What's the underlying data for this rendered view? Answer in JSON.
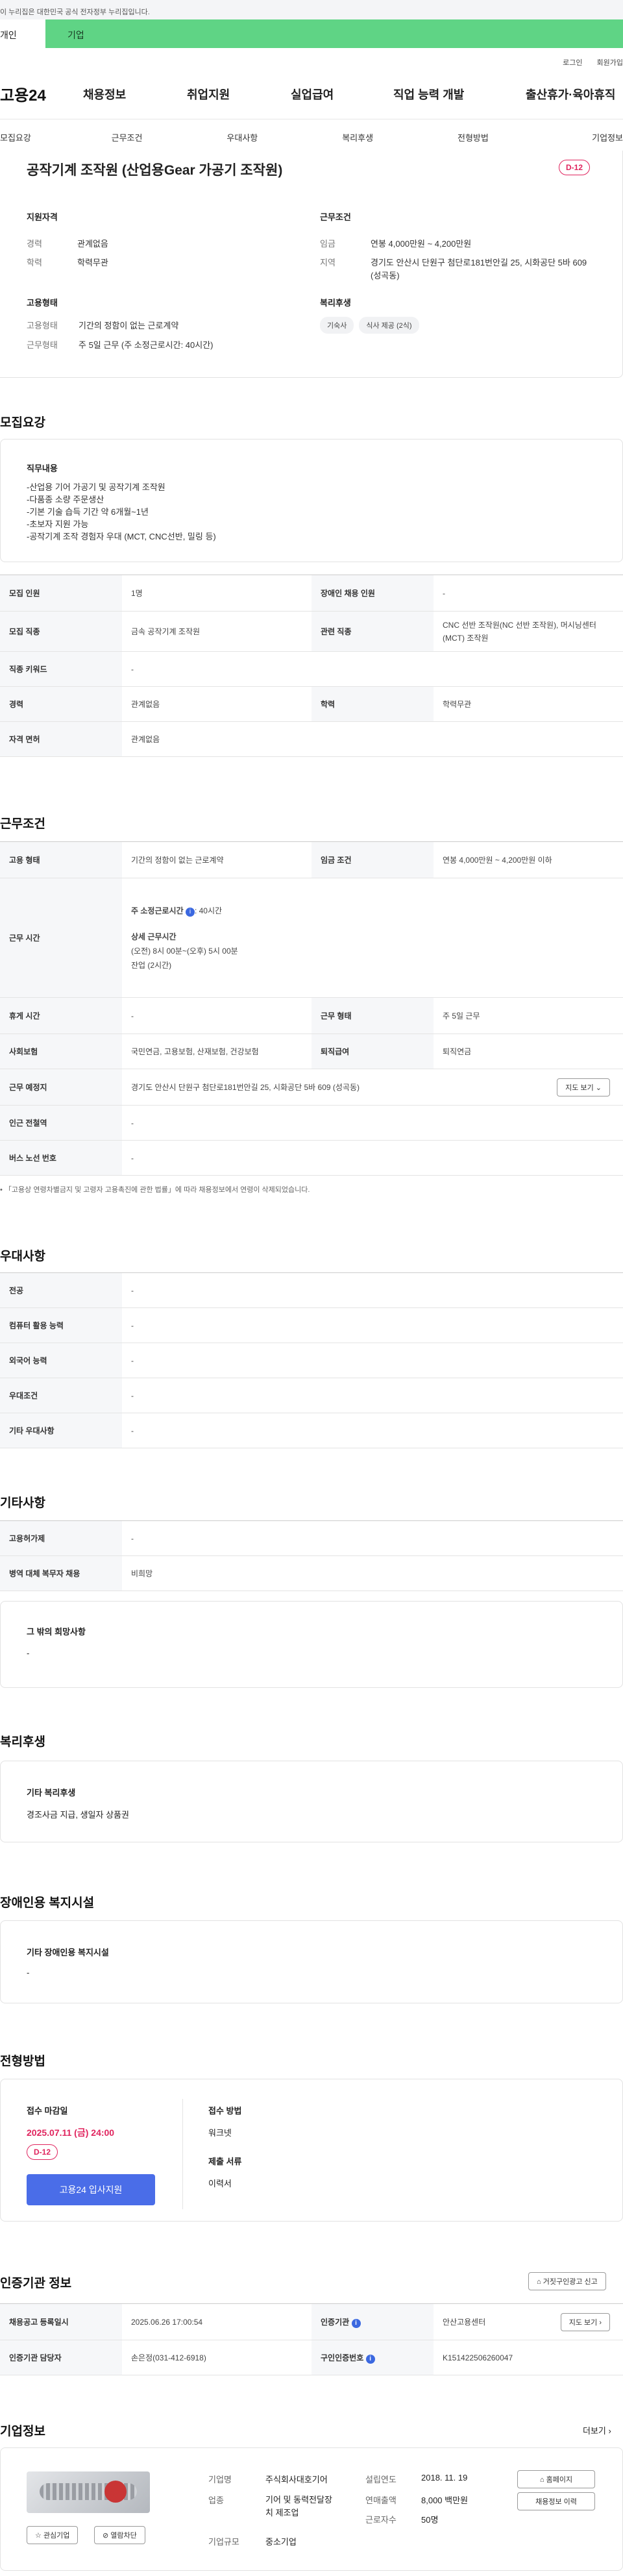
{
  "gov_banner": "이 누리집은 대한민국 공식 전자정부 누리집입니다.",
  "tabs": {
    "person": "개인",
    "company": "기업"
  },
  "util": {
    "login": "로그인",
    "join": "회원가입"
  },
  "brand": "고용24",
  "gnb": [
    "채용정보",
    "취업지원",
    "실업급여",
    "직업 능력 개발",
    "출산휴가·육아휴직"
  ],
  "anchors": [
    "모집요강",
    "근무조건",
    "우대사항",
    "복리후생",
    "전형방법",
    "기업정보"
  ],
  "summary": {
    "title": "공작기계 조작원 (산업용Gear 가공기 조작원)",
    "dday": "D-12",
    "qual_title": "지원자격",
    "qual": [
      {
        "k": "경력",
        "v": "관계없음"
      },
      {
        "k": "학력",
        "v": "학력무관"
      }
    ],
    "emp_title": "고용형태",
    "emp": [
      {
        "k": "고용형태",
        "v": "기간의 정함이 없는 근로계약"
      },
      {
        "k": "근무형태",
        "v": "주 5일 근무 (주 소정근로시간: 40시간)"
      }
    ],
    "cond_title": "근무조건",
    "cond": [
      {
        "k": "임금",
        "v": "연봉 4,000만원 ~ 4,200만원"
      },
      {
        "k": "지역",
        "v": "경기도 안산시 단원구 첨단로181번안길 25, 시화공단 5바 609 (성곡동)"
      }
    ],
    "welfare_title": "복리후생",
    "welfare_tags": [
      "기숙사",
      "식사 제공 (2식)"
    ]
  },
  "recruit": {
    "title": "모집요강",
    "duty_title": "직무내용",
    "duty_lines": [
      "-산업용 기어 가공기 및 공작기계 조작원",
      "-다품종 소량 주문생산",
      "-기본 기술 습득 기간 약 6개월~1년",
      "-초보자 지원 가능",
      "-공작기계 조작 경험자 우대 (MCT, CNC선반, 밀링 등)"
    ],
    "rows": [
      {
        "k1": "모집 인원",
        "v1": "1명",
        "k2": "장애인 채용 인원",
        "v2": "-"
      },
      {
        "k1": "모집 직종",
        "v1": "금속 공작기계 조작원",
        "k2": "관련 직종",
        "v2": "CNC 선반 조작원(NC 선반 조작원), 머시닝센터(MCT) 조작원"
      },
      {
        "k1": "직종 키워드",
        "v1": "-"
      },
      {
        "k1": "경력",
        "v1": "관계없음",
        "k2": "학력",
        "v2": "학력무관"
      },
      {
        "k1": "자격 면허",
        "v1": "관계없음"
      }
    ]
  },
  "work": {
    "title": "근무조건",
    "emp_type_k": "고용 형태",
    "emp_type_v": "기간의 정함이 없는 근로계약",
    "wage_k": "임금 조건",
    "wage_v": "연봉 4,000만원 ~ 4,200만원 이하",
    "hours_k": "근무 시간",
    "hours_weekly": "주 소정근로시간",
    "hours_weekly_v": ": 40시간",
    "hours_detail_title": "상세 근무시간",
    "hours_detail_1": "(오전) 8시 00분~(오후) 5시 00분",
    "hours_detail_2": "잔업 (2시간)",
    "rest_k": "휴게 시간",
    "rest_v": "-",
    "shift_k": "근무 형태",
    "shift_v": "주 5일 근무",
    "ins_k": "사회보험",
    "ins_v": "국민연금, 고용보험, 산재보험, 건강보험",
    "sev_k": "퇴직급여",
    "sev_v": "퇴직연금",
    "place_k": "근무 예정지",
    "place_v": "경기도 안산시 단원구 첨단로181번안길 25, 시화공단 5바 609 (성곡동)",
    "map_btn": "지도 보기",
    "subway_k": "인근 전철역",
    "subway_v": "-",
    "bus_k": "버스 노선 번호",
    "bus_v": "-",
    "note": "「고용상 연령차별금지 및 고령자 고용촉진에 관한 법률」에 따라 채용정보에서 연령이 삭제되었습니다."
  },
  "pref": {
    "title": "우대사항",
    "rows": [
      {
        "k": "전공",
        "v": "-"
      },
      {
        "k": "컴퓨터 활용 능력",
        "v": "-"
      },
      {
        "k": "외국어 능력",
        "v": "-"
      },
      {
        "k": "우대조건",
        "v": "-"
      },
      {
        "k": "기타 우대사항",
        "v": "-"
      }
    ]
  },
  "etc": {
    "title": "기타사항",
    "rows": [
      {
        "k": "고용허가제",
        "v": "-"
      },
      {
        "k": "병역 대체 복무자 채용",
        "v": "비희망"
      }
    ],
    "hope_title": "그 밖의 희망사항",
    "hope_v": "-"
  },
  "welfare": {
    "title": "복리후생",
    "box_title": "기타 복리후생",
    "box_v": "경조사금 지급, 생일자 상품권"
  },
  "disabled": {
    "title": "장애인용 복지시설",
    "box_title": "기타 장애인용 복지시설",
    "box_v": "-"
  },
  "selection": {
    "title": "전형방법",
    "deadline_title": "접수 마감일",
    "deadline": "2025.07.11 (금) 24:00",
    "dday": "D-12",
    "apply_btn": "고용24 입사지원",
    "method_title": "접수 방법",
    "method_v": "워크넷",
    "docs_title": "제출 서류",
    "docs_v": "이력서"
  },
  "agency": {
    "title": "인증기관 정보",
    "report_btn": "거짓구인광고 신고",
    "reg_k": "채용공고 등록일시",
    "reg_v": "2025.06.26 17:00:54",
    "org_k": "인증기관",
    "org_v": "안산고용센터",
    "map_btn": "지도 보기",
    "mgr_k": "인증기관 담당자",
    "mgr_v": "손은정(031-412-6918)",
    "num_k": "구인인증번호",
    "num_v": "K151422506260047"
  },
  "company": {
    "title": "기업정보",
    "more": "더보기",
    "interest_btn": "관심기업",
    "block_btn": "열람차단",
    "name_k": "기업명",
    "name_v": "주식회사대호기어",
    "biz_k": "업종",
    "biz_v": "기어 및 동력전달장치 제조업",
    "size_k": "기업규모",
    "size_v": "중소기업",
    "year_k": "설립연도",
    "year_v": "2018. 11. 19",
    "sales_k": "연매출액",
    "sales_v": "8,000 백만원",
    "staff_k": "근로자수",
    "staff_v": "50명",
    "home_btn": "홈페이지",
    "history_btn": "채용정보 이력"
  }
}
